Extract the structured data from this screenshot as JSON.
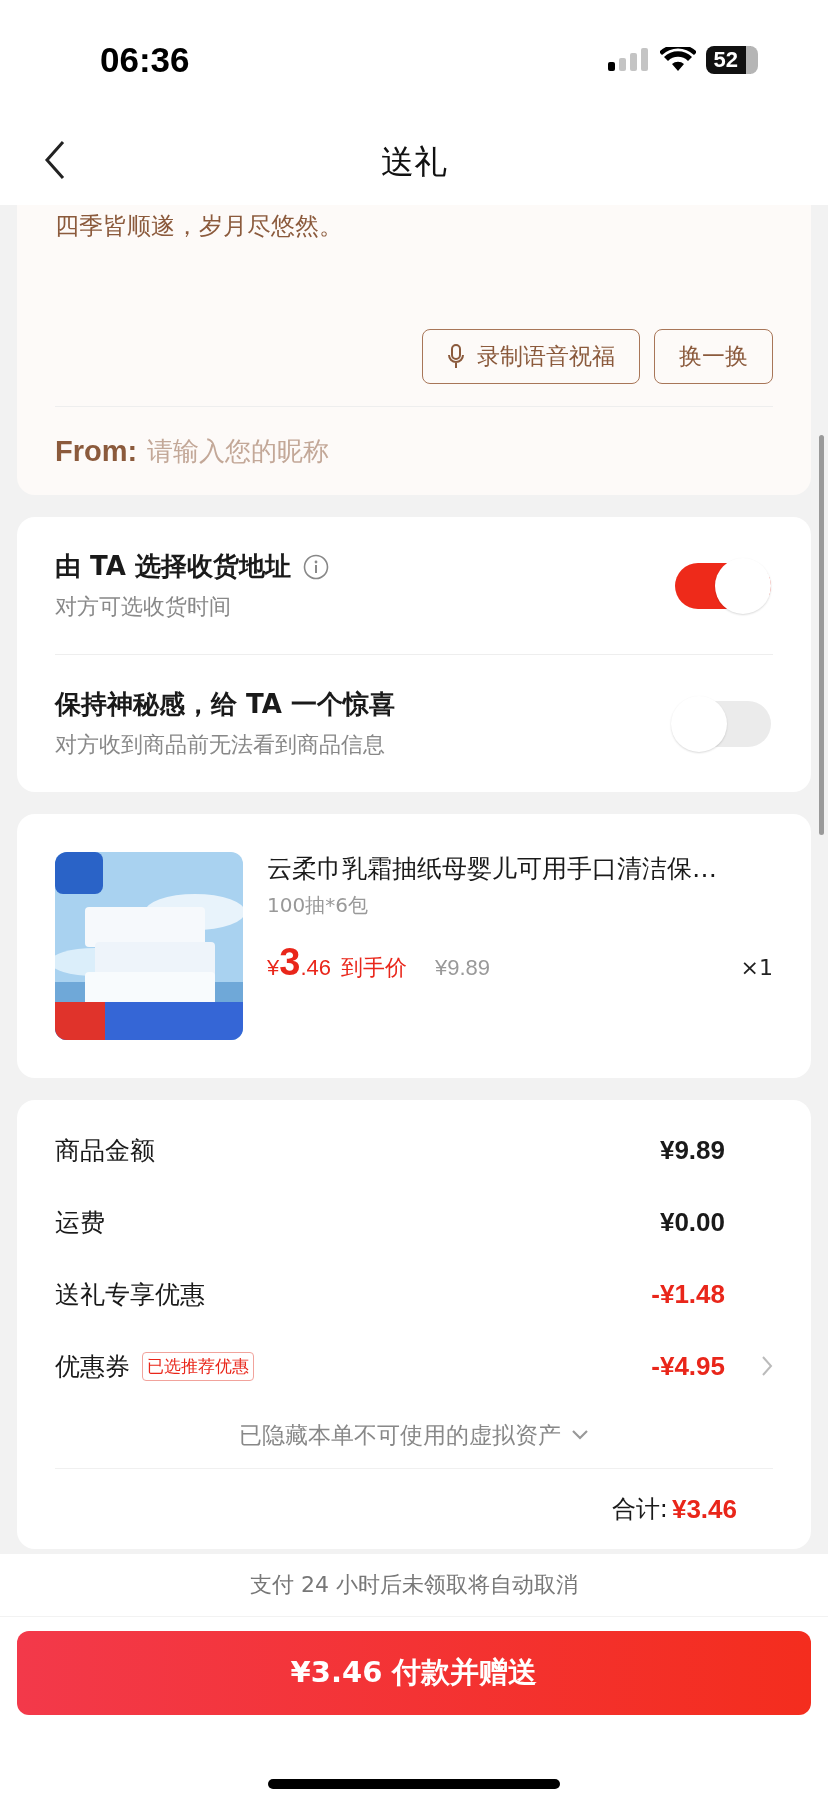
{
  "status_bar": {
    "time": "06:36",
    "battery": "52"
  },
  "nav": {
    "title": "送礼"
  },
  "greeting": {
    "message": "四季皆顺遂，岁月尽悠然。",
    "voice_button": "录制语音祝福",
    "swap_button": "换一换",
    "from_label": "From:",
    "from_placeholder": "请输入您的昵称"
  },
  "options": [
    {
      "title": "由 TA 选择收货地址",
      "subtitle": "对方可选收货时间",
      "on": true,
      "info": true
    },
    {
      "title": "保持神秘感，给 TA 一个惊喜",
      "subtitle": "对方收到商品前无法看到商品信息",
      "on": false,
      "info": false
    }
  ],
  "product": {
    "title": "云柔巾乳霜抽纸母婴儿可用手口清洁保…",
    "spec": "100抽*6包",
    "price_symbol": "¥",
    "price_int": "3",
    "price_dec": ".46",
    "price_label": "到手价",
    "original_price": "¥9.89",
    "quantity": "×1"
  },
  "fees": [
    {
      "kind": "plain",
      "label": "商品金额",
      "value": "¥9.89"
    },
    {
      "kind": "plain",
      "label": "运费",
      "value": "¥0.00"
    },
    {
      "kind": "discount",
      "label": "送礼专享优惠",
      "value": "-¥1.48"
    },
    {
      "kind": "coupon",
      "label": "优惠券",
      "tag": "已选推荐优惠",
      "value": "-¥4.95"
    }
  ],
  "hidden_assets": "已隐藏本单不可使用的虚拟资产",
  "total": {
    "label": "合计:",
    "value": "¥3.46"
  },
  "notice": "支付 24 小时后未领取将自动取消",
  "pay_button": "¥3.46 付款并赠送"
}
